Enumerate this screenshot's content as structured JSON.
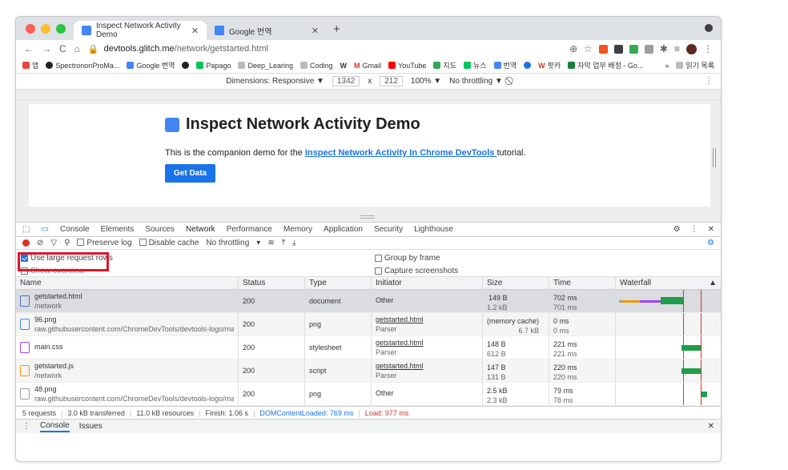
{
  "browser": {
    "active_tab_title": "Inspect Network Activity Demo",
    "second_tab_title": "Google 번역",
    "url_host": "devtools.glitch.me",
    "url_path": "/network/getstarted.html",
    "bookmarks": [
      "앱",
      "SpectrononProMa...",
      "Google 번역",
      "Papago",
      "Deep_Learing",
      "Coding",
      "W",
      "Gmail",
      "YouTube",
      "지도",
      "뉴스",
      "번역",
      "팟카",
      "자막 업무 배정 - Go...",
      "»",
      "읽기 목록"
    ]
  },
  "device_toolbar": {
    "dimensions_label": "Dimensions: Responsive ▼",
    "width": "1342",
    "times": "x",
    "height": "212",
    "zoom": "100% ▼",
    "throttle": "No throttling ▼"
  },
  "page": {
    "heading": "Inspect Network Activity Demo",
    "intro_before": "This is the companion demo for the ",
    "intro_link": "Inspect Network Activity In Chrome DevTools ",
    "intro_after": "tutorial.",
    "button": "Get Data"
  },
  "devtools": {
    "tabs": [
      "Console",
      "Elements",
      "Sources",
      "Network",
      "Performance",
      "Memory",
      "Application",
      "Security",
      "Lighthouse"
    ],
    "toolbar": {
      "preserve_log": "Preserve log",
      "disable_cache": "Disable cache",
      "throttling": "No throttling"
    },
    "settings": {
      "large_rows": "Use large request rows",
      "show_overview": "Show overview",
      "group_by_frame": "Group by frame",
      "capture_screenshots": "Capture screenshots"
    },
    "columns": [
      "Name",
      "Status",
      "Type",
      "Initiator",
      "Size",
      "Time",
      "Waterfall"
    ],
    "rows": [
      {
        "name": "getstarted.html",
        "path": "/network",
        "status": "200",
        "type": "document",
        "initiator": "Other",
        "initiator_sub": "",
        "size": "149 B",
        "size_sub": "1.2 kB",
        "time": "702 ms",
        "time_sub": "701 ms",
        "icon_color": "#4a6fd8"
      },
      {
        "name": "96.png",
        "path": "raw.githubusercontent.com/ChromeDevTools/devtools-logo/ma...",
        "status": "200",
        "type": "png",
        "initiator": "getstarted.html",
        "initiator_sub": "Parser",
        "size": "(memory cache)",
        "size_sub": "6.7 kB",
        "time": "0 ms",
        "time_sub": "0 ms",
        "icon_color": "#4285f4"
      },
      {
        "name": "main.css",
        "path": "",
        "status": "200",
        "type": "stylesheet",
        "initiator": "getstarted.html",
        "initiator_sub": "Parser",
        "size": "148 B",
        "size_sub": "612 B",
        "time": "221 ms",
        "time_sub": "221 ms",
        "icon_color": "#a142f4"
      },
      {
        "name": "getstarted.js",
        "path": "/network",
        "status": "200",
        "type": "script",
        "initiator": "getstarted.html",
        "initiator_sub": "Parser",
        "size": "147 B",
        "size_sub": "131 B",
        "time": "220 ms",
        "time_sub": "220 ms",
        "icon_color": "#f29900"
      },
      {
        "name": "48.png",
        "path": "raw.githubusercontent.com/ChromeDevTools/devtools-logo/ma...",
        "status": "200",
        "type": "png",
        "initiator": "Other",
        "initiator_sub": "",
        "size": "2.5 kB",
        "size_sub": "2.3 kB",
        "time": "79 ms",
        "time_sub": "78 ms",
        "icon_color": "#9aa0a6"
      }
    ],
    "status": {
      "requests": "5 requests",
      "transferred": "3.0 kB transferred",
      "resources": "11.0 kB resources",
      "finish": "Finish: 1.06 s",
      "dcl": "DOMContentLoaded: 769 ms",
      "load": "Load: 977 ms"
    },
    "drawer": [
      "Console",
      "Issues"
    ]
  },
  "colors": {
    "accent": "#1a73e8",
    "highlight_box": "#e0152a",
    "dcl_line": "#1a73e8",
    "load_line": "#d93025",
    "waterfall_bar": "#1e9e47"
  }
}
